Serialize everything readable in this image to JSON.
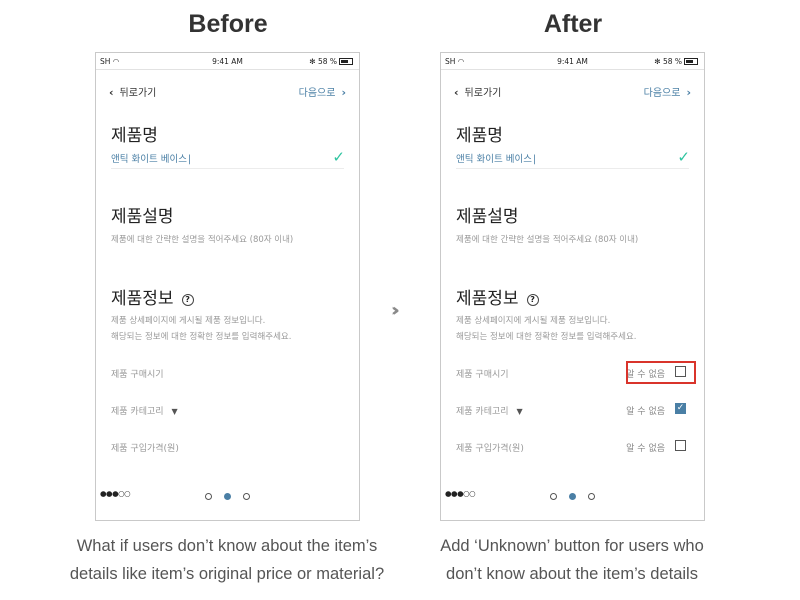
{
  "headings": {
    "before": "Before",
    "after": "After"
  },
  "status_bar": {
    "carrier": "SH",
    "dots": "●●●○○",
    "time": "9:41 AM",
    "battery": "58 %",
    "bluetooth": "✻"
  },
  "nav": {
    "back_label": "뒤로가기",
    "next_label": "다음으로"
  },
  "product_name": {
    "title": "제품명",
    "value": "앤틱 화이트 베이스"
  },
  "product_description": {
    "title": "제품설명",
    "placeholder": "제품에 대한 간략한 설명을 적어주세요 (80자 이내)"
  },
  "product_info": {
    "title": "제품정보",
    "help_text": "?",
    "description_line1": "제품 상세페이지에 게시될 제품 정보입니다.",
    "description_line2": "해당되는 정보에 대한 정확한 정보를 입력해주세요.",
    "fields": [
      {
        "label": "제품 구매시기",
        "dropdown": false,
        "unknown_checked": false
      },
      {
        "label": "제품 카테고리",
        "dropdown": true,
        "unknown_checked": true
      },
      {
        "label": "제품 구입가격(원)",
        "dropdown": false,
        "unknown_checked": false
      }
    ],
    "unknown_label": "알 수 없음"
  },
  "pagination": {
    "total": 3,
    "active_index": 1
  },
  "captions": {
    "before_line1": "What if users don’t know about the item’s",
    "before_line2": "details like item’s original price or material?",
    "after_line1": "Add ‘Unknown’ button for users who",
    "after_line2": "don’t know about the item’s details"
  },
  "colors": {
    "accent": "#4a7fa5",
    "check_green": "#2ec4a0",
    "highlight_red": "#d9342b"
  },
  "icons": {
    "transition": "double-chevron-right-icon"
  }
}
